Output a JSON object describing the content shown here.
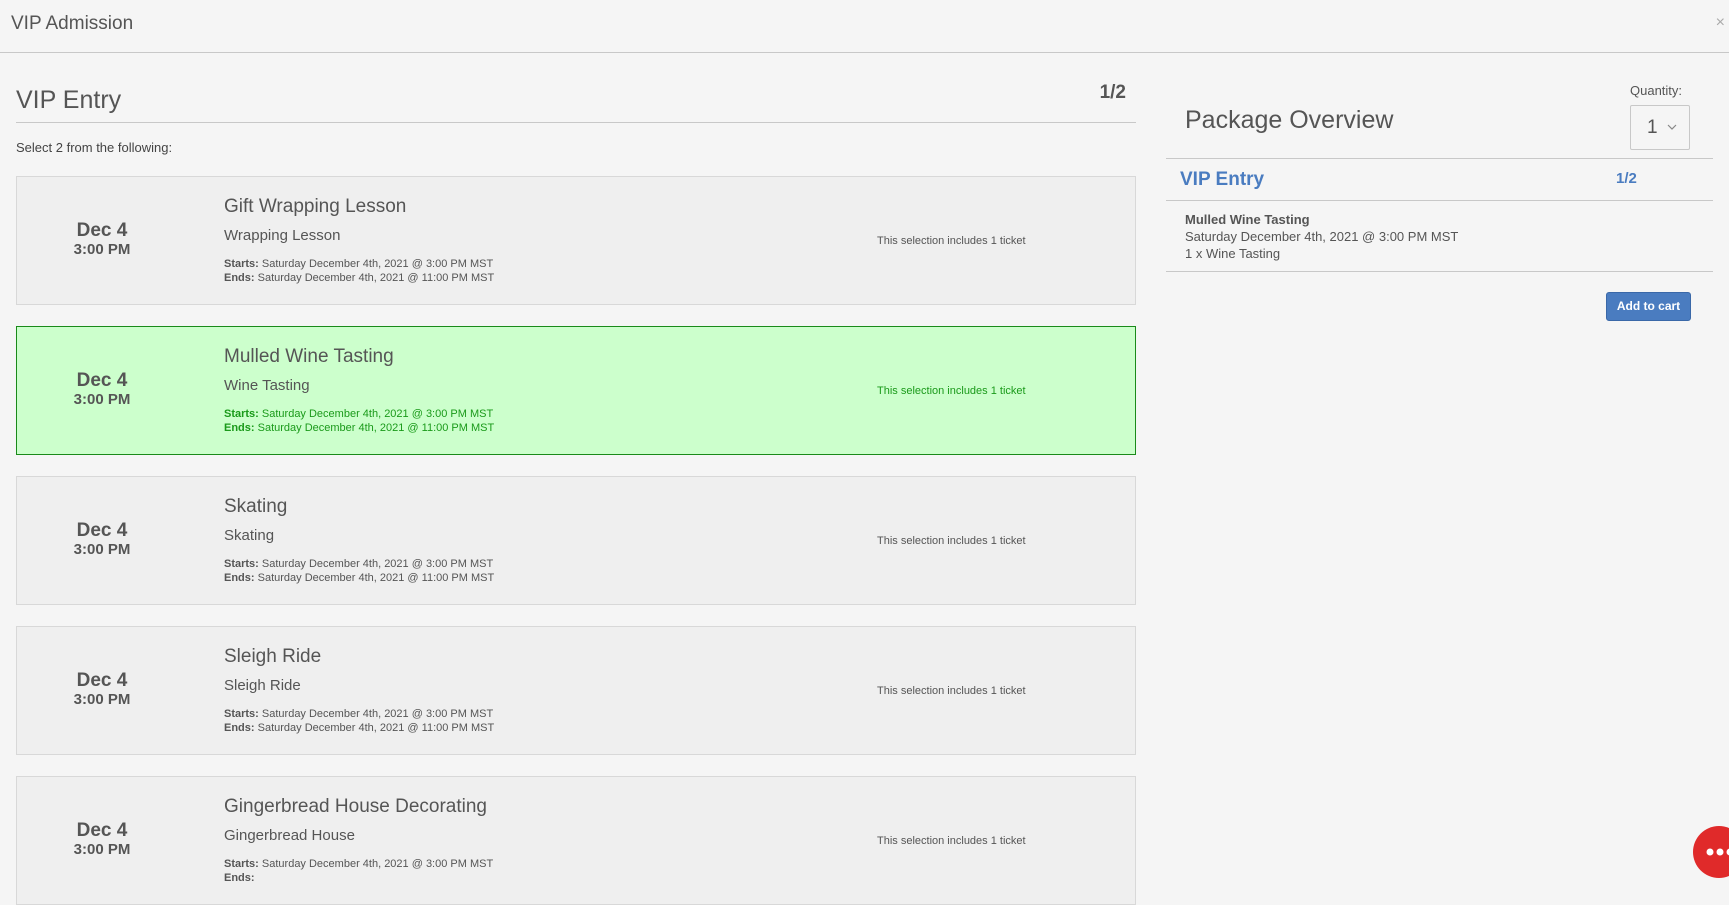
{
  "modal": {
    "title": "VIP Admission",
    "close": "×"
  },
  "section": {
    "title": "VIP Entry",
    "count": "1/2",
    "instructions": "Select 2 from the following:"
  },
  "options": [
    {
      "date": "Dec 4",
      "time": "3:00 PM",
      "title": "Gift Wrapping Lesson",
      "subtitle": "Wrapping Lesson",
      "starts_label": "Starts:",
      "starts": "Saturday December 4th, 2021 @ 3:00 PM MST",
      "ends_label": "Ends:",
      "ends": "Saturday December 4th, 2021 @ 11:00 PM MST",
      "includes": "This selection includes 1 ticket",
      "selected": false
    },
    {
      "date": "Dec 4",
      "time": "3:00 PM",
      "title": "Mulled Wine Tasting",
      "subtitle": "Wine Tasting",
      "starts_label": "Starts:",
      "starts": "Saturday December 4th, 2021 @ 3:00 PM MST",
      "ends_label": "Ends:",
      "ends": "Saturday December 4th, 2021 @ 11:00 PM MST",
      "includes": "This selection includes 1 ticket",
      "selected": true
    },
    {
      "date": "Dec 4",
      "time": "3:00 PM",
      "title": "Skating",
      "subtitle": "Skating",
      "starts_label": "Starts:",
      "starts": "Saturday December 4th, 2021 @ 3:00 PM MST",
      "ends_label": "Ends:",
      "ends": "Saturday December 4th, 2021 @ 11:00 PM MST",
      "includes": "This selection includes 1 ticket",
      "selected": false
    },
    {
      "date": "Dec 4",
      "time": "3:00 PM",
      "title": "Sleigh Ride",
      "subtitle": "Sleigh Ride",
      "starts_label": "Starts:",
      "starts": "Saturday December 4th, 2021 @ 3:00 PM MST",
      "ends_label": "Ends:",
      "ends": "Saturday December 4th, 2021 @ 11:00 PM MST",
      "includes": "This selection includes 1 ticket",
      "selected": false
    },
    {
      "date": "Dec 4",
      "time": "3:00 PM",
      "title": "Gingerbread House Decorating",
      "subtitle": "Gingerbread House",
      "starts_label": "Starts:",
      "starts": "Saturday December 4th, 2021 @ 3:00 PM MST",
      "ends_label": "Ends:",
      "ends": "",
      "includes": "This selection includes 1 ticket",
      "selected": false
    }
  ],
  "overview": {
    "title": "Package Overview",
    "quantity_label": "Quantity:",
    "quantity_value": "1",
    "section_title": "VIP Entry",
    "section_count": "1/2",
    "item_title": "Mulled Wine Tasting",
    "item_date": "Saturday December 4th, 2021 @ 3:00 PM MST",
    "item_qty": "1 x Wine Tasting",
    "add_to_cart": "Add to cart"
  },
  "colors": {
    "accent": "#4a7cc0",
    "selected_bg": "#ccffcc",
    "selected_text": "#1a9a1a",
    "chat": "#e02a2a"
  },
  "icons": {
    "close": "close-icon",
    "quantity_dropdown": "chevron-down-icon",
    "chat": "chat-icon"
  }
}
